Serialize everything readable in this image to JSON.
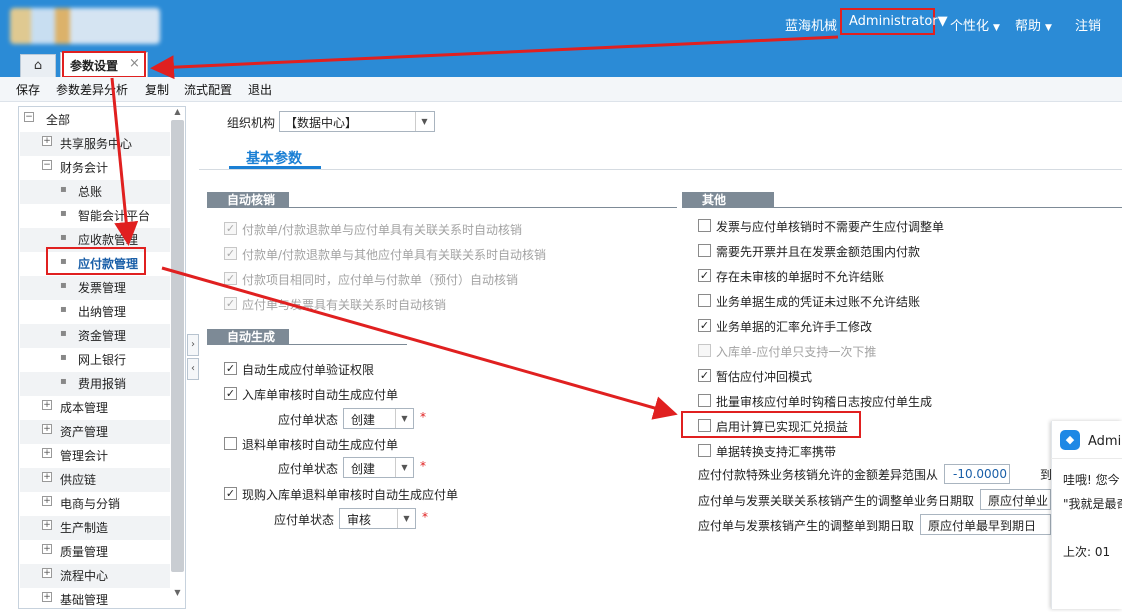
{
  "header": {
    "org_name": "蓝海机械",
    "user": "Administrator",
    "personalize": "个性化",
    "help": "帮助",
    "logout": "注销"
  },
  "tabs": {
    "home_icon": "home-icon",
    "active_tab": "参数设置",
    "close_glyph": "×"
  },
  "toolbar": {
    "save": "保存",
    "diff": "参数差异分析",
    "copy": "复制",
    "flow": "流式配置",
    "exit": "退出"
  },
  "sidebar": {
    "items": [
      {
        "label": "全部",
        "type": "top",
        "exp": "⊟"
      },
      {
        "label": "共享服务中心",
        "type": "group",
        "exp": "+"
      },
      {
        "label": "财务会计",
        "type": "group",
        "exp": "−"
      },
      {
        "label": "总账",
        "type": "child"
      },
      {
        "label": "智能会计平台",
        "type": "child"
      },
      {
        "label": "应收款管理",
        "type": "child"
      },
      {
        "label": "应付款管理",
        "type": "child",
        "selected": true
      },
      {
        "label": "发票管理",
        "type": "child"
      },
      {
        "label": "出纳管理",
        "type": "child"
      },
      {
        "label": "资金管理",
        "type": "child"
      },
      {
        "label": "网上银行",
        "type": "child"
      },
      {
        "label": "费用报销",
        "type": "child"
      },
      {
        "label": "成本管理",
        "type": "group",
        "exp": "+"
      },
      {
        "label": "资产管理",
        "type": "group",
        "exp": "+"
      },
      {
        "label": "管理会计",
        "type": "group",
        "exp": "+"
      },
      {
        "label": "供应链",
        "type": "group",
        "exp": "+"
      },
      {
        "label": "电商与分销",
        "type": "group",
        "exp": "+"
      },
      {
        "label": "生产制造",
        "type": "group",
        "exp": "+"
      },
      {
        "label": "质量管理",
        "type": "group",
        "exp": "+"
      },
      {
        "label": "流程中心",
        "type": "group",
        "exp": "+"
      },
      {
        "label": "基础管理",
        "type": "group",
        "exp": "+"
      }
    ]
  },
  "content": {
    "org_label": "组织机构",
    "org_value": "【数据中心】",
    "basic_tab": "基本参数",
    "auto_writeoff": {
      "title": "自动核销",
      "items": [
        "付款单/付款退款单与应付单具有关联关系时自动核销",
        "付款单/付款退款单与其他应付单具有关联关系时自动核销",
        "付款项目相同时，应付单与付款单（预付）自动核销",
        "应付单与发票具有关联关系时自动核销"
      ]
    },
    "auto_generate": {
      "title": "自动生成",
      "verify": "自动生成应付单验证权限",
      "inbound": "入库单审核时自动生成应付单",
      "status_label": "应付单状态",
      "inbound_status": "创建",
      "return": "退料单审核时自动生成应付单",
      "return_status": "创建",
      "purchase": "现购入库单退料单审核时自动生成应付单",
      "purchase_status": "审核",
      "required_mark": "*"
    },
    "other": {
      "title": "其他",
      "items": [
        {
          "label": "发票与应付单核销时不需要产生应付调整单",
          "checked": false
        },
        {
          "label": "需要先开票并且在发票金额范围内付款",
          "checked": false
        },
        {
          "label": "存在未审核的单据时不允许结账",
          "checked": true
        },
        {
          "label": "业务单据生成的凭证未过账不允许结账",
          "checked": false
        },
        {
          "label": "业务单据的汇率允许手工修改",
          "checked": true
        },
        {
          "label": "入库单-应付单只支持一次下推",
          "checked": false,
          "disabled": true
        },
        {
          "label": "暂估应付冲回模式",
          "checked": true
        },
        {
          "label": "批量审核应付单时钩稽日志按应付单生成",
          "checked": false
        },
        {
          "label": "启用计算已实现汇兑损益",
          "checked": false
        },
        {
          "label": "单据转换支持汇率携带",
          "checked": false
        }
      ],
      "tolerance_label": "应付付款特殊业务核销允许的金额差异范围从",
      "tolerance_value": "-10.0000",
      "tolerance_to": "到",
      "invoice_date_label": "应付单与发票关联关系核销产生的调整单业务日期取",
      "invoice_date_value": "原应付单业",
      "due_date_label": "应付单与发票核销产生的调整单到期日取",
      "due_date_value": "原应付单最早到期日"
    }
  },
  "chat": {
    "title": "Admi",
    "line1": "哇哦! 您今",
    "line2": "\"我就是最奇",
    "line3": "上次: 01"
  },
  "colors": {
    "header_blue": "#2b8bd6",
    "highlight_red": "#e02020",
    "accent_blue": "#1a7fd4"
  }
}
